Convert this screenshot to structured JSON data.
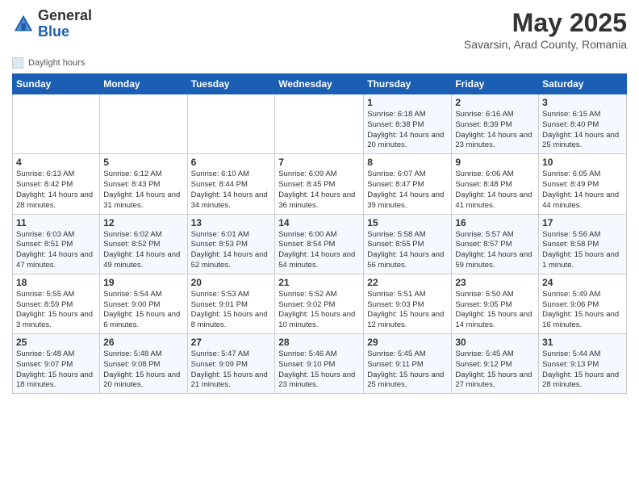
{
  "header": {
    "logo_general": "General",
    "logo_blue": "Blue",
    "month_title": "May 2025",
    "subtitle": "Savarsin, Arad County, Romania"
  },
  "legend": {
    "label": "Daylight hours"
  },
  "days_of_week": [
    "Sunday",
    "Monday",
    "Tuesday",
    "Wednesday",
    "Thursday",
    "Friday",
    "Saturday"
  ],
  "weeks": [
    [
      {
        "day": "",
        "info": ""
      },
      {
        "day": "",
        "info": ""
      },
      {
        "day": "",
        "info": ""
      },
      {
        "day": "",
        "info": ""
      },
      {
        "day": "1",
        "info": "Sunrise: 6:18 AM\nSunset: 8:38 PM\nDaylight: 14 hours and 20 minutes."
      },
      {
        "day": "2",
        "info": "Sunrise: 6:16 AM\nSunset: 8:39 PM\nDaylight: 14 hours and 23 minutes."
      },
      {
        "day": "3",
        "info": "Sunrise: 6:15 AM\nSunset: 8:40 PM\nDaylight: 14 hours and 25 minutes."
      }
    ],
    [
      {
        "day": "4",
        "info": "Sunrise: 6:13 AM\nSunset: 8:42 PM\nDaylight: 14 hours and 28 minutes."
      },
      {
        "day": "5",
        "info": "Sunrise: 6:12 AM\nSunset: 8:43 PM\nDaylight: 14 hours and 31 minutes."
      },
      {
        "day": "6",
        "info": "Sunrise: 6:10 AM\nSunset: 8:44 PM\nDaylight: 14 hours and 34 minutes."
      },
      {
        "day": "7",
        "info": "Sunrise: 6:09 AM\nSunset: 8:45 PM\nDaylight: 14 hours and 36 minutes."
      },
      {
        "day": "8",
        "info": "Sunrise: 6:07 AM\nSunset: 8:47 PM\nDaylight: 14 hours and 39 minutes."
      },
      {
        "day": "9",
        "info": "Sunrise: 6:06 AM\nSunset: 8:48 PM\nDaylight: 14 hours and 41 minutes."
      },
      {
        "day": "10",
        "info": "Sunrise: 6:05 AM\nSunset: 8:49 PM\nDaylight: 14 hours and 44 minutes."
      }
    ],
    [
      {
        "day": "11",
        "info": "Sunrise: 6:03 AM\nSunset: 8:51 PM\nDaylight: 14 hours and 47 minutes."
      },
      {
        "day": "12",
        "info": "Sunrise: 6:02 AM\nSunset: 8:52 PM\nDaylight: 14 hours and 49 minutes."
      },
      {
        "day": "13",
        "info": "Sunrise: 6:01 AM\nSunset: 8:53 PM\nDaylight: 14 hours and 52 minutes."
      },
      {
        "day": "14",
        "info": "Sunrise: 6:00 AM\nSunset: 8:54 PM\nDaylight: 14 hours and 54 minutes."
      },
      {
        "day": "15",
        "info": "Sunrise: 5:58 AM\nSunset: 8:55 PM\nDaylight: 14 hours and 56 minutes."
      },
      {
        "day": "16",
        "info": "Sunrise: 5:57 AM\nSunset: 8:57 PM\nDaylight: 14 hours and 59 minutes."
      },
      {
        "day": "17",
        "info": "Sunrise: 5:56 AM\nSunset: 8:58 PM\nDaylight: 15 hours and 1 minute."
      }
    ],
    [
      {
        "day": "18",
        "info": "Sunrise: 5:55 AM\nSunset: 8:59 PM\nDaylight: 15 hours and 3 minutes."
      },
      {
        "day": "19",
        "info": "Sunrise: 5:54 AM\nSunset: 9:00 PM\nDaylight: 15 hours and 6 minutes."
      },
      {
        "day": "20",
        "info": "Sunrise: 5:53 AM\nSunset: 9:01 PM\nDaylight: 15 hours and 8 minutes."
      },
      {
        "day": "21",
        "info": "Sunrise: 5:52 AM\nSunset: 9:02 PM\nDaylight: 15 hours and 10 minutes."
      },
      {
        "day": "22",
        "info": "Sunrise: 5:51 AM\nSunset: 9:03 PM\nDaylight: 15 hours and 12 minutes."
      },
      {
        "day": "23",
        "info": "Sunrise: 5:50 AM\nSunset: 9:05 PM\nDaylight: 15 hours and 14 minutes."
      },
      {
        "day": "24",
        "info": "Sunrise: 5:49 AM\nSunset: 9:06 PM\nDaylight: 15 hours and 16 minutes."
      }
    ],
    [
      {
        "day": "25",
        "info": "Sunrise: 5:48 AM\nSunset: 9:07 PM\nDaylight: 15 hours and 18 minutes."
      },
      {
        "day": "26",
        "info": "Sunrise: 5:48 AM\nSunset: 9:08 PM\nDaylight: 15 hours and 20 minutes."
      },
      {
        "day": "27",
        "info": "Sunrise: 5:47 AM\nSunset: 9:09 PM\nDaylight: 15 hours and 21 minutes."
      },
      {
        "day": "28",
        "info": "Sunrise: 5:46 AM\nSunset: 9:10 PM\nDaylight: 15 hours and 23 minutes."
      },
      {
        "day": "29",
        "info": "Sunrise: 5:45 AM\nSunset: 9:11 PM\nDaylight: 15 hours and 25 minutes."
      },
      {
        "day": "30",
        "info": "Sunrise: 5:45 AM\nSunset: 9:12 PM\nDaylight: 15 hours and 27 minutes."
      },
      {
        "day": "31",
        "info": "Sunrise: 5:44 AM\nSunset: 9:13 PM\nDaylight: 15 hours and 28 minutes."
      }
    ]
  ]
}
